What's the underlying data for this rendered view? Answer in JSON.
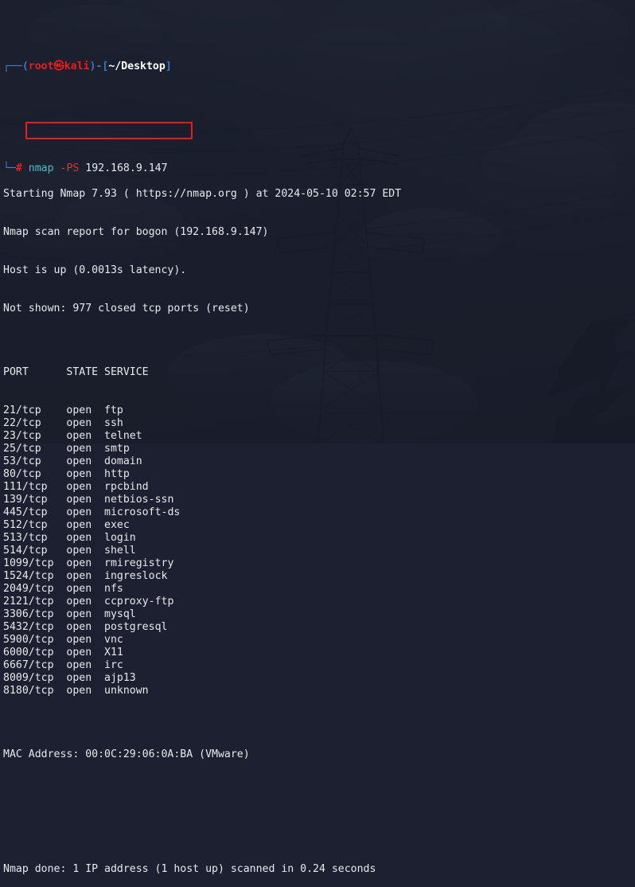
{
  "window": {
    "app": "Terminal",
    "background_style": "kali-dark-wallpaper"
  },
  "colors": {
    "terminal_bg": "#181c29",
    "text": "#e8e9ed",
    "prompt_red": "#ef1b1b",
    "prompt_blue": "#3b76c4",
    "command_cyan": "#44c0c8",
    "flag_red": "#e03030",
    "highlight_box": "#e51f1f"
  },
  "prompt": {
    "frame_top": "┌──",
    "frame_bottom": "└─",
    "open_paren": "(",
    "user": "root",
    "at": "㉿",
    "host": "kali",
    "close_paren": ")",
    "dash_bracket": "-[",
    "path": "~/Desktop",
    "close_bracket": "]",
    "hash": "#"
  },
  "command": {
    "program": "nmap",
    "flag": "-PS",
    "argument": "192.168.9.147",
    "highlighted": true
  },
  "output": {
    "header_lines": [
      "Starting Nmap 7.93 ( https://nmap.org ) at 2024-05-10 02:57 EDT",
      "Nmap scan report for bogon (192.168.9.147)",
      "Host is up (0.0013s latency).",
      "Not shown: 977 closed tcp ports (reset)"
    ],
    "table_header": "PORT      STATE SERVICE",
    "columns": [
      "PORT",
      "STATE",
      "SERVICE"
    ],
    "ports": [
      {
        "port": "21/tcp",
        "state": "open",
        "service": "ftp"
      },
      {
        "port": "22/tcp",
        "state": "open",
        "service": "ssh"
      },
      {
        "port": "23/tcp",
        "state": "open",
        "service": "telnet"
      },
      {
        "port": "25/tcp",
        "state": "open",
        "service": "smtp"
      },
      {
        "port": "53/tcp",
        "state": "open",
        "service": "domain"
      },
      {
        "port": "80/tcp",
        "state": "open",
        "service": "http"
      },
      {
        "port": "111/tcp",
        "state": "open",
        "service": "rpcbind"
      },
      {
        "port": "139/tcp",
        "state": "open",
        "service": "netbios-ssn"
      },
      {
        "port": "445/tcp",
        "state": "open",
        "service": "microsoft-ds"
      },
      {
        "port": "512/tcp",
        "state": "open",
        "service": "exec"
      },
      {
        "port": "513/tcp",
        "state": "open",
        "service": "login"
      },
      {
        "port": "514/tcp",
        "state": "open",
        "service": "shell"
      },
      {
        "port": "1099/tcp",
        "state": "open",
        "service": "rmiregistry"
      },
      {
        "port": "1524/tcp",
        "state": "open",
        "service": "ingreslock"
      },
      {
        "port": "2049/tcp",
        "state": "open",
        "service": "nfs"
      },
      {
        "port": "2121/tcp",
        "state": "open",
        "service": "ccproxy-ftp"
      },
      {
        "port": "3306/tcp",
        "state": "open",
        "service": "mysql"
      },
      {
        "port": "5432/tcp",
        "state": "open",
        "service": "postgresql"
      },
      {
        "port": "5900/tcp",
        "state": "open",
        "service": "vnc"
      },
      {
        "port": "6000/tcp",
        "state": "open",
        "service": "X11"
      },
      {
        "port": "6667/tcp",
        "state": "open",
        "service": "irc"
      },
      {
        "port": "8009/tcp",
        "state": "open",
        "service": "ajp13"
      },
      {
        "port": "8180/tcp",
        "state": "open",
        "service": "unknown"
      }
    ],
    "mac_address_line": "MAC Address: 00:0C:29:06:0A:BA (VMware)",
    "summary_line": "Nmap done: 1 IP address (1 host up) scanned in 0.24 seconds"
  }
}
